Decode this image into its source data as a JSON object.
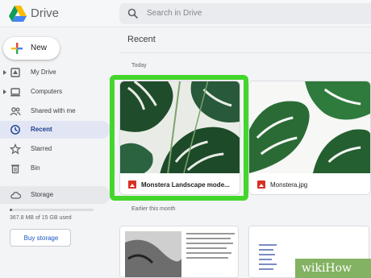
{
  "header": {
    "brand": "Drive",
    "search_placeholder": "Search in Drive"
  },
  "sidebar": {
    "new_label": "New",
    "items": [
      {
        "label": "My Drive",
        "icon": "my-drive-icon",
        "expandable": true
      },
      {
        "label": "Computers",
        "icon": "computer-icon",
        "expandable": true
      },
      {
        "label": "Shared with me",
        "icon": "people-icon",
        "expandable": false
      },
      {
        "label": "Recent",
        "icon": "clock-icon",
        "expandable": false,
        "active": true
      },
      {
        "label": "Starred",
        "icon": "star-icon",
        "expandable": false
      },
      {
        "label": "Bin",
        "icon": "trash-icon",
        "expandable": false
      },
      {
        "label": "Storage",
        "icon": "cloud-icon",
        "expandable": false
      }
    ],
    "storage": {
      "used_text": "367.8 MB of 15 GB used",
      "fill_fraction": 0.03
    },
    "buy_label": "Buy storage"
  },
  "main": {
    "title": "Recent",
    "sections": [
      "Today",
      "Earlier this month"
    ],
    "files": [
      {
        "name": "Monstera Landscape mode...",
        "type": "image",
        "highlighted": true
      },
      {
        "name": "Monstera.jpg",
        "type": "image",
        "highlighted": false
      }
    ]
  },
  "watermark": {
    "text": "wikiHow"
  },
  "colors": {
    "highlight": "#44d62c",
    "active_nav": "#e2e6f4",
    "image_file": "#d93025",
    "link": "#1a56c4"
  }
}
